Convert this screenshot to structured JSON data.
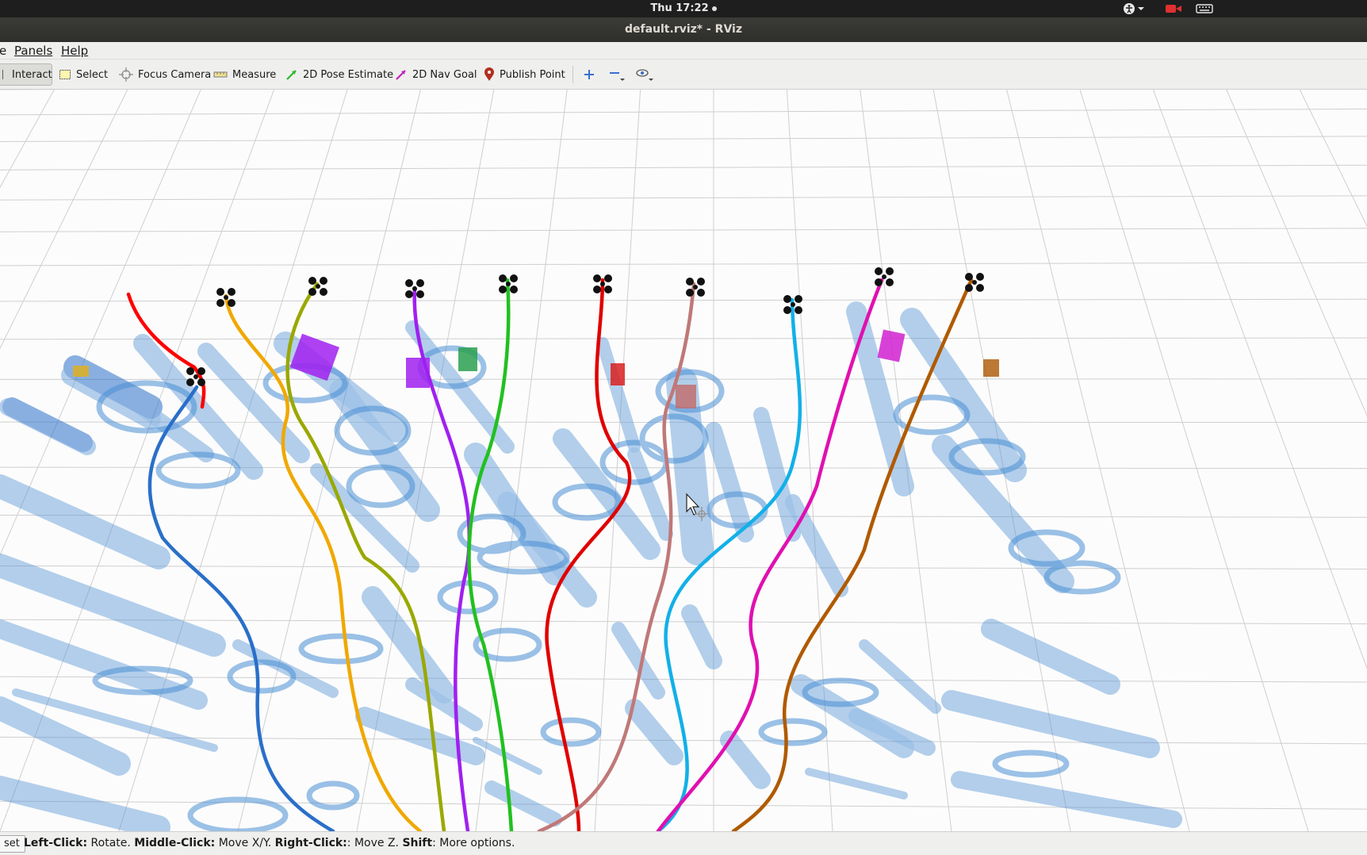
{
  "system_bar": {
    "clock": "Thu 17:22"
  },
  "window": {
    "title": "default.rviz* - RViz"
  },
  "menu": {
    "file_label": "e",
    "panels_label": "Panels",
    "help_label": "Help"
  },
  "toolbar": {
    "interact": "Interact",
    "select": "Select",
    "focus_camera": "Focus Camera",
    "measure": "Measure",
    "pose_estimate": "2D Pose Estimate",
    "nav_goal": "2D Nav Goal",
    "publish_point": "Publish Point"
  },
  "status": {
    "reset_label": "set",
    "left_click_key": "Left-Click:",
    "left_click_text": " Rotate. ",
    "middle_click_key": "Middle-Click:",
    "middle_click_text": " Move X/Y. ",
    "right_click_key": "Right-Click:",
    "right_click_text": ": Move Z. ",
    "shift_key": "Shift",
    "shift_text": ": More options."
  },
  "colors": {
    "grid": "#cfcfcf",
    "obstacle": "#4a8fd4",
    "trajectories": [
      "#ff0000",
      "#2a6fc9",
      "#f0a800",
      "#9aa800",
      "#a020f0",
      "#22c020",
      "#e00000",
      "#c07878",
      "#12b0e8",
      "#e010b0",
      "#b05a00"
    ]
  },
  "icons": {
    "accessibility": "accessibility-icon",
    "camera": "camera-icon",
    "keyboard": "keyboard-icon",
    "interact": "cursor-icon",
    "select": "selection-box-icon",
    "focus": "crosshair-icon",
    "measure": "ruler-icon",
    "pose": "green-arrow-icon",
    "goal": "magenta-arrow-icon",
    "point": "map-pin-icon",
    "zoom_in": "plus-icon",
    "zoom_out": "minus-icon",
    "view": "eye-icon"
  }
}
